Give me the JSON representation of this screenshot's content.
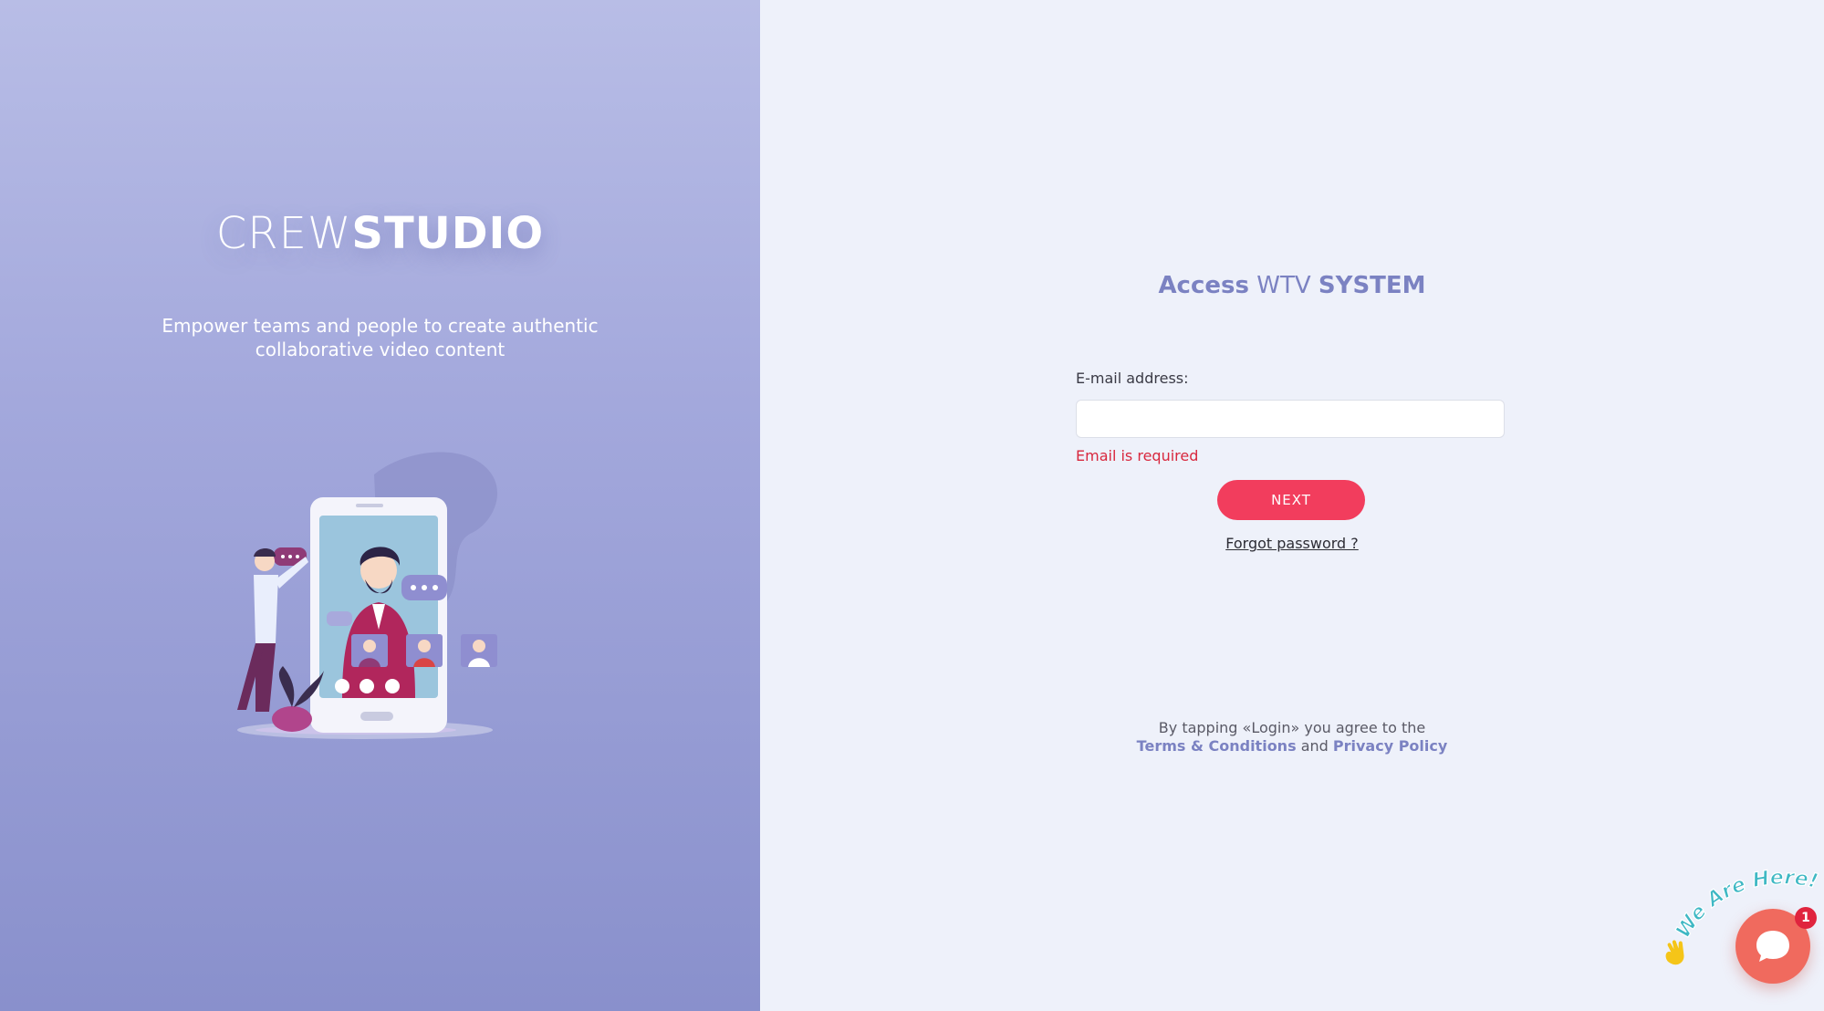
{
  "brand": {
    "light": "CREW",
    "bold": "STUDIO",
    "tagline": "Empower teams and people to create authentic collaborative video content"
  },
  "login": {
    "title_access": "Access",
    "title_wtv": "WTV",
    "title_system": "SYSTEM",
    "email_label": "E-mail address:",
    "email_value": "",
    "email_placeholder": "",
    "error_text": "Email is required",
    "next_label": "NEXT",
    "forgot_label": "Forgot password ?"
  },
  "terms": {
    "prefix": "By tapping «Login» you agree to the",
    "terms_label": "Terms & Conditions",
    "and": "and",
    "privacy_label": "Privacy Policy"
  },
  "chat": {
    "banner": "We Are Here!",
    "badge_count": "1",
    "icon": "chat-bubble-icon",
    "hand_icon": "waving-hand-icon"
  },
  "colors": {
    "accent": "#7b82c2",
    "primary_button": "#f23d5d",
    "error": "#d8283e",
    "chat_button": "#f06a5e",
    "left_panel": "#a3a8dc",
    "right_panel": "#eef1fa"
  }
}
